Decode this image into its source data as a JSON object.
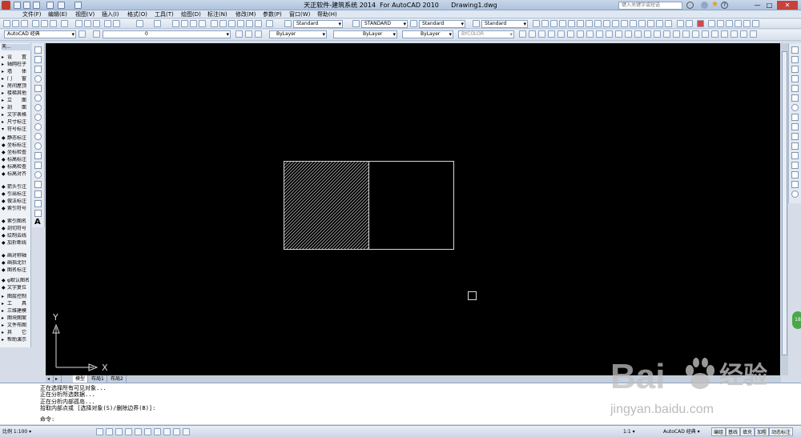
{
  "window": {
    "title": "天正软件-建筑系统 2014  For AutoCAD 2010      Drawing1.dwg",
    "search_placeholder": "键入关键字或短语",
    "minimize": "—",
    "maximize": "□",
    "close": "✕"
  },
  "menu": [
    "文件(F)",
    "编辑(E)",
    "视图(V)",
    "插入(I)",
    "格式(O)",
    "工具(T)",
    "绘图(D)",
    "标注(N)",
    "修改(M)",
    "参数(P)",
    "窗口(W)",
    "帮助(H)"
  ],
  "toolbar1": {
    "text_style": "Standard",
    "dim_style": "STANDARD",
    "table_style": "Standard",
    "mleader_style": "Standard"
  },
  "toolbar2": {
    "workspace": "AutoCAD 经典",
    "layer": "0",
    "color": "ByLayer",
    "linetype": "ByLayer",
    "lineweight": "ByLayer",
    "plotstyle": "BYCOLOR"
  },
  "tianzheng_menu": {
    "header": "天...",
    "items": [
      {
        "icon": "▸",
        "label": "设　　置"
      },
      {
        "icon": "▸",
        "label": "轴网柱子"
      },
      {
        "icon": "▸",
        "label": "墙　　体"
      },
      {
        "icon": "▸",
        "label": "门　　窗"
      },
      {
        "icon": "▸",
        "label": "房间屋顶"
      },
      {
        "icon": "▸",
        "label": "楼梯其他"
      },
      {
        "icon": "▸",
        "label": "立　　面"
      },
      {
        "icon": "▸",
        "label": "剖　　面"
      },
      {
        "icon": "▸",
        "label": "文字表格"
      },
      {
        "icon": "▸",
        "label": "尺寸标注"
      },
      {
        "icon": "▾",
        "label": "符号标注"
      },
      {
        "icon": "◆",
        "label": "静态标注"
      },
      {
        "icon": "◆",
        "label": "坐标标注"
      },
      {
        "icon": "◆",
        "label": "坐标检查"
      },
      {
        "icon": "◆",
        "label": "标高标注"
      },
      {
        "icon": "◆",
        "label": "标高检查"
      },
      {
        "icon": "◆",
        "label": "标高对齐"
      },
      {
        "icon": "◆",
        "label": "箭头引注"
      },
      {
        "icon": "◆",
        "label": "引出标注"
      },
      {
        "icon": "◆",
        "label": "做法标注"
      },
      {
        "icon": "◆",
        "label": "索引符号"
      },
      {
        "icon": "◆",
        "label": "索引图名"
      },
      {
        "icon": "◆",
        "label": "剖切符号"
      },
      {
        "icon": "◆",
        "label": "绘制云线"
      },
      {
        "icon": "◆",
        "label": "加折断线"
      },
      {
        "icon": "◆",
        "label": "画对称轴"
      },
      {
        "icon": "◆",
        "label": "画指北针"
      },
      {
        "icon": "◆",
        "label": "图名标注"
      },
      {
        "icon": "◆",
        "label": "φ默认图名"
      },
      {
        "icon": "◆",
        "label": "文字复位"
      },
      {
        "icon": "▸",
        "label": "图层控制"
      },
      {
        "icon": "▸",
        "label": "工　　具"
      },
      {
        "icon": "▸",
        "label": "三维建模"
      },
      {
        "icon": "▸",
        "label": "图块图案"
      },
      {
        "icon": "▸",
        "label": "文件布图"
      },
      {
        "icon": "▸",
        "label": "其　　它"
      },
      {
        "icon": "▸",
        "label": "帮助演示"
      }
    ]
  },
  "ucs": {
    "x_label": "X",
    "y_label": "Y"
  },
  "layout_tabs": [
    "模型",
    "布局1",
    "布局2"
  ],
  "command_history": [
    "正在选择所有可见对象...",
    "正在分析所选数据...",
    "正在分析内部孤岛...",
    "拾取内部点或 [选择对象(S)/删除边界(B)]:"
  ],
  "command_prompt": "命令:",
  "status": {
    "scale": "比例 1:100 ▾",
    "annotation_scale": "1:1 ▾",
    "workspace": "AutoCAD 经典 ▾",
    "buttons": [
      "编组",
      "基线",
      "填充",
      "加粗",
      "动态标注"
    ]
  },
  "watermark": {
    "brand_left": "Bai",
    "brand_right": "经验",
    "url": "jingyan.baidu.com"
  },
  "badge": "18",
  "colors": {
    "canvas": "#000000",
    "hatch": "#c8c8c8",
    "accent": "#4aa84a"
  }
}
